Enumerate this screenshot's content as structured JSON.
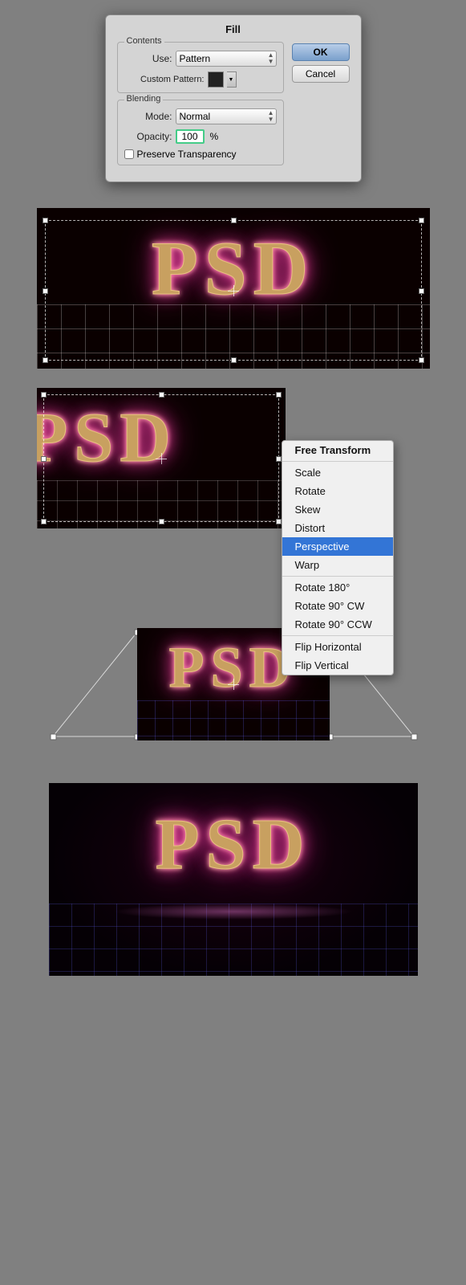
{
  "dialog": {
    "title": "Fill",
    "contents_label": "Contents",
    "use_label": "Use:",
    "use_value": "Pattern",
    "custom_pattern_label": "Custom Pattern:",
    "blending_label": "Blending",
    "mode_label": "Mode:",
    "mode_value": "Normal",
    "opacity_label": "Opacity:",
    "opacity_value": "100",
    "opacity_unit": "%",
    "preserve_label": "Preserve Transparency",
    "ok_label": "OK",
    "cancel_label": "Cancel"
  },
  "context_menu": {
    "items": [
      {
        "label": "Free Transform",
        "type": "bold",
        "highlighted": false
      },
      {
        "label": "Scale",
        "type": "normal",
        "highlighted": false
      },
      {
        "label": "Rotate",
        "type": "normal",
        "highlighted": false
      },
      {
        "label": "Skew",
        "type": "normal",
        "highlighted": false
      },
      {
        "label": "Distort",
        "type": "normal",
        "highlighted": false
      },
      {
        "label": "Perspective",
        "type": "normal",
        "highlighted": true
      },
      {
        "label": "Warp",
        "type": "normal",
        "highlighted": false
      },
      {
        "label": "separator1",
        "type": "separator"
      },
      {
        "label": "Rotate 180°",
        "type": "normal",
        "highlighted": false
      },
      {
        "label": "Rotate 90° CW",
        "type": "normal",
        "highlighted": false
      },
      {
        "label": "Rotate 90° CCW",
        "type": "normal",
        "highlighted": false
      },
      {
        "label": "separator2",
        "type": "separator"
      },
      {
        "label": "Flip Horizontal",
        "type": "normal",
        "highlighted": false
      },
      {
        "label": "Flip Vertical",
        "type": "normal",
        "highlighted": false
      }
    ]
  }
}
